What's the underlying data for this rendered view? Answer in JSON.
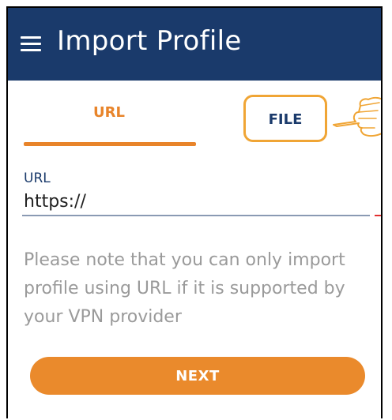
{
  "app_bar": {
    "title": "Import Profile",
    "menu_icon": "hamburger-menu-icon",
    "background": "#1a3a6b"
  },
  "tabs": [
    {
      "label": "URL",
      "active": true
    },
    {
      "label": "FILE",
      "active": false,
      "highlighted": true
    }
  ],
  "pointer_icon": "pointing-hand-icon",
  "url_field": {
    "label": "URL",
    "value": "https://"
  },
  "note": "Please note that you can only import profile using URL if it is supported by your VPN provider",
  "next_button": {
    "label": "NEXT"
  },
  "colors": {
    "accent": "#ea8a2c",
    "highlight_outline": "#f0a535",
    "primary": "#1a3a6b",
    "muted_text": "#9a9a9a"
  }
}
